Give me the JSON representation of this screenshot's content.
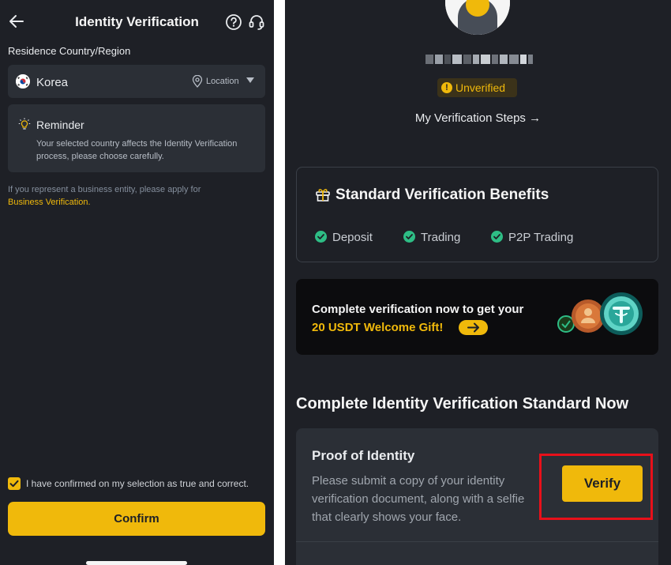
{
  "left_screen": {
    "header": {
      "title": "Identity Verification",
      "back_icon": "arrow-left-icon",
      "help_icon": "question-circle-icon",
      "support_icon": "headset-icon"
    },
    "residence": {
      "label": "Residence Country/Region",
      "selected_country": "Korea",
      "flag_icon": "korea-flag-icon",
      "location_label": "Location",
      "location_icon": "map-pin-icon"
    },
    "reminder": {
      "title": "Reminder",
      "text": "Your selected country affects the Identity Verification process, please choose carefully.",
      "icon": "lightbulb-icon"
    },
    "business": {
      "text": "If you represent a business entity, please apply for",
      "link": "Business Verification."
    },
    "confirmation": {
      "checked": true,
      "label": "I have confirmed on my selection as true and correct."
    },
    "confirm_button": "Confirm"
  },
  "right_screen": {
    "profile": {
      "status_badge": "Unverified",
      "steps_link": "My Verification Steps →"
    },
    "benefits": {
      "title": "Standard Verification Benefits",
      "items": [
        "Deposit",
        "Trading",
        "P2P Trading"
      ]
    },
    "banner": {
      "line1": "Complete verification now to get your",
      "line2": "20 USDT Welcome Gift!"
    },
    "section_title": "Complete Identity Verification Standard Now",
    "proof_card": {
      "title": "Proof of Identity",
      "description": "Please submit a copy of your identity verification document, along with a selfie that clearly shows your face.",
      "verify_button": "Verify"
    }
  },
  "colors": {
    "background": "#1e2026",
    "card": "#2b2f36",
    "accent": "#f0b90b",
    "success": "#2ebd85",
    "highlight": "#e8101a"
  }
}
